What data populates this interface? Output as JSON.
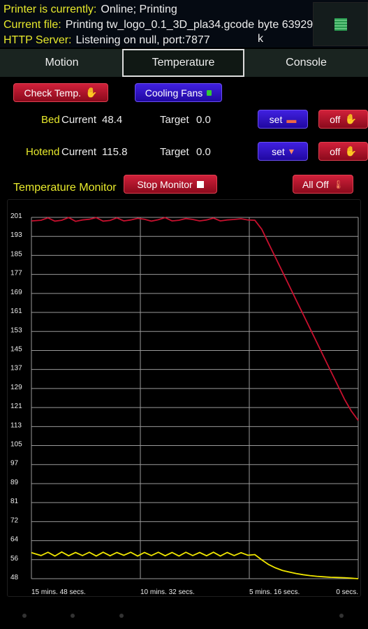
{
  "status": {
    "printer_label": "Printer is currently:",
    "printer_value": "Online; Printing",
    "file_label": "Current file:",
    "file_value": "Printing tw_logo_0.1_3D_pla34.gcode",
    "byte_value": "byte 63929 k",
    "http_label": "HTTP Server:",
    "http_value": "Listening on null, port:7877",
    "icon": "green-grid-icon"
  },
  "tabs": [
    {
      "label": "Motion"
    },
    {
      "label": "Temperature",
      "active": true
    },
    {
      "label": "Console"
    }
  ],
  "controls": {
    "check_temp": "Check Temp.",
    "cooling_fans": "Cooling Fans",
    "bed": {
      "label": "Bed",
      "current_label": "Current",
      "current": "48.4",
      "target_label": "Target",
      "target": "0.0",
      "set": "set",
      "off": "off"
    },
    "hotend": {
      "label": "Hotend",
      "current_label": "Current",
      "current": "115.8",
      "target_label": "Target",
      "target": "0.0",
      "set": "set",
      "off": "off"
    },
    "monitor_label": "Temperature Monitor",
    "stop_monitor": "Stop Monitor",
    "all_off": "All Off"
  },
  "colors": {
    "label": "#e8ea2c",
    "hotend_series": "#c8102e",
    "bed_series": "#f0e600",
    "red_button": "#b01028",
    "blue_button": "#3010c8"
  },
  "chart_data": {
    "type": "line",
    "ylim": [
      48,
      201
    ],
    "yticks": [
      "201",
      "193",
      "185",
      "177",
      "169",
      "161",
      "153",
      "145",
      "137",
      "129",
      "121",
      "113",
      "105",
      "97",
      "89",
      "81",
      "72",
      "64",
      "56",
      "48"
    ],
    "xlim": [
      948,
      0
    ],
    "xticks": [
      {
        "value": 948,
        "label": "15 mins. 48 secs."
      },
      {
        "value": 632,
        "label": "10 mins. 32 secs."
      },
      {
        "value": 316,
        "label": "5 mins. 16 secs."
      },
      {
        "value": 0,
        "label": "0 secs."
      }
    ],
    "grid": true,
    "x": [
      948,
      920,
      900,
      880,
      860,
      840,
      820,
      800,
      780,
      760,
      740,
      720,
      700,
      680,
      660,
      640,
      620,
      600,
      580,
      560,
      540,
      520,
      500,
      480,
      460,
      440,
      420,
      400,
      380,
      360,
      340,
      320,
      300,
      280,
      260,
      240,
      220,
      200,
      180,
      160,
      140,
      120,
      100,
      80,
      60,
      40,
      20,
      0
    ],
    "series": [
      {
        "color": "#c8102e",
        "values": [
          199.5,
          199.8,
          200.8,
          199.4,
          199.8,
          200.9,
          199.3,
          199.9,
          200.2,
          200.9,
          199.4,
          199.7,
          200.8,
          199.5,
          199.9,
          200.6,
          200.2,
          199.4,
          200.0,
          200.9,
          199.5,
          199.8,
          200.5,
          200.1,
          199.5,
          199.9,
          200.7,
          199.5,
          199.9,
          200.1,
          200.4,
          199.9,
          199.8,
          196,
          190,
          184,
          178,
          172,
          166,
          160,
          154,
          148,
          142,
          136,
          130,
          124,
          119,
          115
        ]
      },
      {
        "color": "#f0e600",
        "values": [
          59,
          57.8,
          59.2,
          57.6,
          59.3,
          57.7,
          59.1,
          57.8,
          59.2,
          57.6,
          59.2,
          57.7,
          59.1,
          57.9,
          59.2,
          57.6,
          59.1,
          57.8,
          59.2,
          57.7,
          59.1,
          57.6,
          59.2,
          57.8,
          59.1,
          57.7,
          59.2,
          57.6,
          59.1,
          57.8,
          59.0,
          57.9,
          58.2,
          56,
          54,
          52.6,
          51.5,
          50.8,
          50.2,
          49.7,
          49.3,
          49.0,
          48.8,
          48.6,
          48.5,
          48.4,
          48.2,
          48.0
        ]
      }
    ]
  }
}
